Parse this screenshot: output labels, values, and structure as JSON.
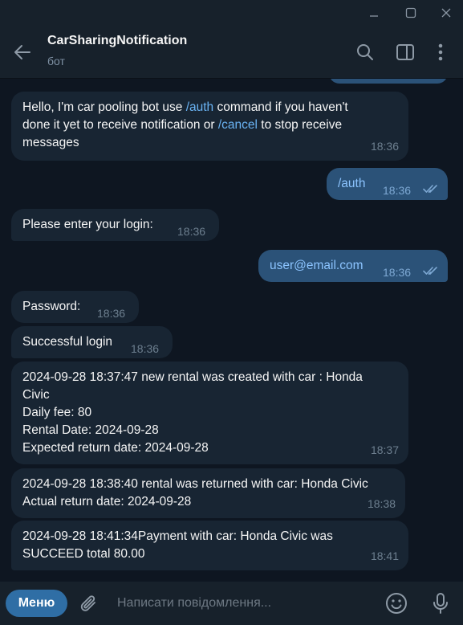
{
  "chat": {
    "title": "CarSharingNotification",
    "subtitle": "бот"
  },
  "messages": [
    {
      "dir": "in",
      "parts": [
        "Hello, I'm car pooling bot use ",
        "/auth",
        " command if you haven't",
        "done it yet to receive notification or ",
        "/cancel",
        " to stop receive",
        "messages"
      ],
      "time": "18:36"
    },
    {
      "dir": "out",
      "text": "/auth",
      "time": "18:36",
      "read": true
    },
    {
      "dir": "in",
      "text": "Please enter your login:",
      "time": "18:36"
    },
    {
      "dir": "out",
      "text": "user@email.com",
      "time": "18:36",
      "read": true
    },
    {
      "dir": "in",
      "text": "Password:",
      "time": "18:36"
    },
    {
      "dir": "in",
      "text": "Successful login",
      "time": "18:36"
    },
    {
      "dir": "in",
      "lines": [
        "2024-09-28 18:37:47 new rental was created with car : Honda",
        "Civic",
        "Daily fee: 80",
        "Rental Date: 2024-09-28",
        "Expected return date: 2024-09-28"
      ],
      "time": "18:37"
    },
    {
      "dir": "in",
      "lines": [
        "2024-09-28 18:38:40 rental was returned with car: Honda Civic",
        "Actual return date: 2024-09-28"
      ],
      "time": "18:38"
    },
    {
      "dir": "in",
      "lines": [
        "2024-09-28 18:41:34Payment with car: Honda Civic was",
        "SUCCEED total 80.00"
      ],
      "time": "18:41"
    }
  ],
  "composer": {
    "menu_label": "Меню",
    "placeholder": "Написати повідомлення..."
  },
  "colors": {
    "background": "#0e1621",
    "panel": "#17212b",
    "incoming_bubble": "#182533",
    "outgoing_bubble": "#2b5278",
    "accent": "#2f6ea5",
    "link": "#6ab3f3"
  },
  "icons": [
    "minimize-icon",
    "maximize-icon",
    "close-icon",
    "back-arrow-icon",
    "search-icon",
    "sidebar-toggle-icon",
    "more-vert-icon",
    "read-double-check-icon",
    "paperclip-icon",
    "emoji-icon",
    "microphone-icon"
  ]
}
